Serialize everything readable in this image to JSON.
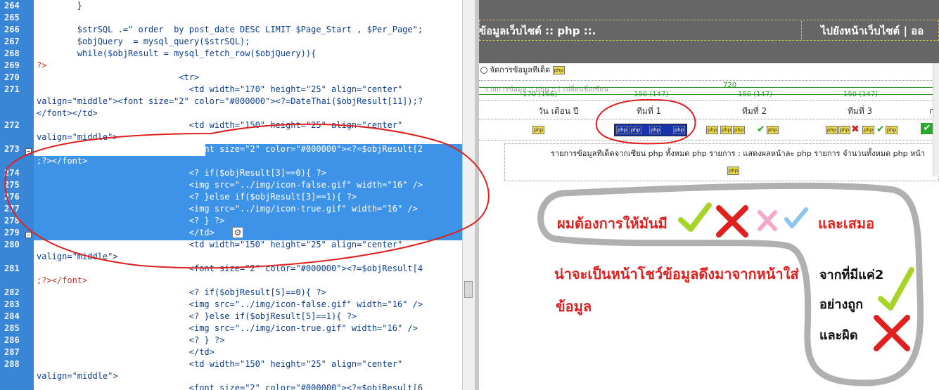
{
  "editor": {
    "lines": [
      {
        "num": "264",
        "text": "        }"
      },
      {
        "num": "265",
        "text": ""
      },
      {
        "num": "266",
        "text": "        $strSQL .=\" order  by post_date DESC LIMIT $Page_Start , $Per_Page\";"
      },
      {
        "num": "267",
        "text": "        $objQuery  = mysql_query($strSQL);"
      },
      {
        "num": "268",
        "text": "        while($objResult = mysql_fetch_row($objQuery)){"
      },
      {
        "num": "269",
        "text": "?>"
      },
      {
        "num": "270",
        "text": "                            <tr>"
      },
      {
        "num": "271",
        "text": "                              <td width=\"170\" height=\"25\" align=\"center\""
      },
      {
        "num": "",
        "text": "valign=\"middle\"><font size=\"2\" color=\"#000000\"><?=DateThai($objResult[11]);?"
      },
      {
        "num": "",
        "text": "</font></td>"
      },
      {
        "num": "272",
        "text": "                              <td width=\"150\" height=\"25\" align=\"center\""
      },
      {
        "num": "",
        "text": "valign=\"middle\">"
      },
      {
        "num": "273",
        "text": "                              <font size=\"2\" color=\"#000000\"><?=$objResult[2"
      },
      {
        "num": "",
        "text": ";?></font>"
      },
      {
        "num": "274",
        "text": "                              <? if($objResult[3]==0){ ?>"
      },
      {
        "num": "275",
        "text": "                              <img src=\"../img/icon-false.gif\" width=\"16\" />"
      },
      {
        "num": "276",
        "text": "                              <? }else if($objResult[3]==1){ ?>"
      },
      {
        "num": "277",
        "text": "                              <img src=\"../img/icon-true.gif\" width=\"16\" />"
      },
      {
        "num": "278",
        "text": "                              <? } ?>"
      },
      {
        "num": "279",
        "text": "                              </td>"
      },
      {
        "num": "280",
        "text": "                              <td width=\"150\" height=\"25\" align=\"center\""
      },
      {
        "num": "",
        "text": "valign=\"middle\">"
      },
      {
        "num": "281",
        "text": "                              <font size=\"2\" color=\"#000000\"><?=$objResult[4"
      },
      {
        "num": "",
        "text": ";?></font>"
      },
      {
        "num": "282",
        "text": "                              <? if($objResult[5]==0){ ?>"
      },
      {
        "num": "283",
        "text": "                              <img src=\"../img/icon-false.gif\" width=\"16\" />"
      },
      {
        "num": "284",
        "text": "                              <? }else if($objResult[5]==1){ ?>"
      },
      {
        "num": "285",
        "text": "                              <img src=\"../img/icon-true.gif\" width=\"16\" />"
      },
      {
        "num": "286",
        "text": "                              <? } ?>"
      },
      {
        "num": "287",
        "text": "                              </td>"
      },
      {
        "num": "288",
        "text": "                              <td width=\"150\" height=\"25\" align=\"center\""
      },
      {
        "num": "",
        "text": "valign=\"middle\">"
      },
      {
        "num": "",
        "text": "                              <font size=\"2\" color=\"#000000\"><?=$objResult[6"
      }
    ]
  },
  "preview": {
    "banner_title": "ข้อมูลเว็บไซต์ :: php ::.",
    "banner_link": "ไปยังหน้าเว็บไซต์ | ออ",
    "manage_label": "จัดการข้อมูลทีเด็ด",
    "php_badge": "php",
    "ruler_total": "720",
    "ruler_cols": [
      "170 (166)",
      "150 (147)",
      "150 (147)",
      "150 (147)"
    ],
    "ruler_hint": "รายการข้อมูล :: php :: [ เปลี่ยนชื่อเซียน",
    "headers": [
      "วัน เดือน ปี",
      "ทีมที่ 1",
      "ทีมที่ 2",
      "ทีมที่ 3",
      "ก"
    ],
    "footer_text": "รายการข้อมูลทีเด็ดจากเซียน php ทั้งหมด php รายการ : แสดงผลหน้าละ php รายการ จำนวนทั้งหมด php หน้า"
  },
  "annotation": {
    "line1": "ผมต้องการให้มันมี",
    "line1_end": "และเสมอ",
    "line2": "น่าจะเป็นหน้าโชว์ข้อมูลดึงมาจากหน้าใส่",
    "line3": "ข้อมูล",
    "right1": "จากที่มีแค่2",
    "right2": "อย่างถูก",
    "right3": "และผิด"
  },
  "colors": {
    "gutter": "#3a86d6",
    "selection": "#3d93e8",
    "annotation_red": "#e0201e",
    "check_green": "#a8d42a",
    "ruler_green": "#2a9a2a"
  }
}
